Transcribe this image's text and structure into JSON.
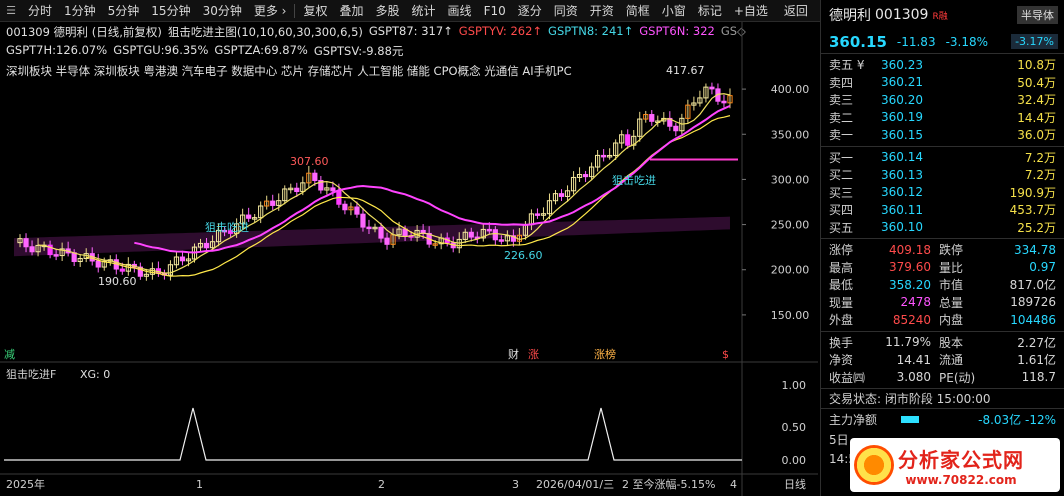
{
  "toolbar": {
    "items": [
      "分时",
      "1分钟",
      "5分钟",
      "15分钟",
      "30分钟",
      "更多 ›",
      "复权",
      "叠加",
      "多股",
      "统计",
      "画线",
      "F10",
      "逐分",
      "同资",
      "开资",
      "简框",
      "小窗",
      "标记",
      "+自选",
      "返回"
    ]
  },
  "chart_header": {
    "stock": "001309 德明利 (日线,前复权)",
    "indicator": "狙击吃进主图(10,10,60,30,300,6,5)",
    "v1": "GSPT87: 317↑",
    "v2": "GSPTYV: 262↑",
    "v3": "GSPTN8: 241↑",
    "v4": "GSPT6N: 322",
    "v5": "GS◇",
    "row2_a": "GSPT7H:126.07%",
    "row2_b": "GSPTGU:96.35%",
    "row2_c": "GSPTZA:69.87%",
    "row2_d": "GSPTSV:-9.88元",
    "concepts": "深圳板块 半导体 深圳板块 粤港澳 汽车电子 数据中心 芯片 存储芯片 人工智能 储能 CPO概念 光通信 AI手机PC"
  },
  "main_chart": {
    "y_ticks": [
      "400.00",
      "350.00",
      "300.00",
      "250.00",
      "200.00",
      "150.00"
    ],
    "annotations": {
      "high": "417.67",
      "peak1": "307.60",
      "low1": "190.60",
      "low2": "226.60",
      "signal1": "狙击吃进",
      "signal2": "狙击吃进"
    },
    "markers": {
      "m1": "减",
      "m2": "财",
      "m3": "涨",
      "m4": "涨榜",
      "m5": "$"
    }
  },
  "sub_chart": {
    "title": "狙击吃进F",
    "value": "XG: 0",
    "y_ticks": [
      "1.00",
      "0.50",
      "0.00"
    ]
  },
  "x_axis": {
    "labels": [
      "2025年",
      "1",
      "2",
      "3",
      "2026/04/01/三",
      "2 至今涨幅-5.15%",
      "4"
    ],
    "period": "日线"
  },
  "quote": {
    "name": "德明利",
    "code": "001309",
    "badge": "R融",
    "sector": "半导体",
    "price": "360.15",
    "change": "-11.83",
    "change_pct": "-3.18%",
    "sector_pct": "-3.17%",
    "asks": [
      {
        "label": "卖五 ¥",
        "price": "360.23",
        "vol": "10.8万"
      },
      {
        "label": "卖四",
        "price": "360.21",
        "vol": "50.4万"
      },
      {
        "label": "卖三",
        "price": "360.20",
        "vol": "32.4万"
      },
      {
        "label": "卖二",
        "price": "360.19",
        "vol": "14.4万"
      },
      {
        "label": "卖一",
        "price": "360.15",
        "vol": "36.0万"
      }
    ],
    "bids": [
      {
        "label": "买一",
        "price": "360.14",
        "vol": "7.2万"
      },
      {
        "label": "买二",
        "price": "360.13",
        "vol": "7.2万"
      },
      {
        "label": "买三",
        "price": "360.12",
        "vol": "190.9万"
      },
      {
        "label": "买四",
        "price": "360.11",
        "vol": "453.7万"
      },
      {
        "label": "买五",
        "price": "360.10",
        "vol": "25.2万"
      }
    ],
    "stats1": [
      {
        "l1": "涨停",
        "v1": "409.18",
        "c1": "#ff4b4b",
        "l2": "跌停",
        "v2": "334.78",
        "c2": "#27d8ff"
      },
      {
        "l1": "最高",
        "v1": "379.60",
        "c1": "#ff4b4b",
        "l2": "量比",
        "v2": "0.97",
        "c2": "#27d8ff"
      },
      {
        "l1": "最低",
        "v1": "358.20",
        "c1": "#27d8ff",
        "l2": "市值",
        "v2": "817.0亿",
        "c2": "#d8d8d8"
      },
      {
        "l1": "现量",
        "v1": "2478",
        "c1": "#ff55ff",
        "l2": "总量",
        "v2": "189726",
        "c2": "#d8d8d8"
      },
      {
        "l1": "外盘",
        "v1": "85240",
        "c1": "#ff4b4b",
        "l2": "内盘",
        "v2": "104486",
        "c2": "#27d8ff"
      }
    ],
    "stats2": [
      {
        "l1": "换手",
        "v1": "11.79%",
        "l2": "股本",
        "v2": "2.27亿"
      },
      {
        "l1": "净资",
        "v1": "14.41",
        "l2": "流通",
        "v2": "1.61亿"
      },
      {
        "l1": "收益㈣",
        "v1": "3.080",
        "l2": "PE(动)",
        "v2": "118.7"
      }
    ],
    "trade_status": "交易状态: 闭市阶段 15:00:00",
    "main_flow_label": "主力净额",
    "main_flow_val": "-8.03亿 -12%",
    "extra1": "5日",
    "extra2": "14:5"
  },
  "watermark": {
    "line1": "分析家公式网",
    "line2": "www.70822.com"
  }
}
